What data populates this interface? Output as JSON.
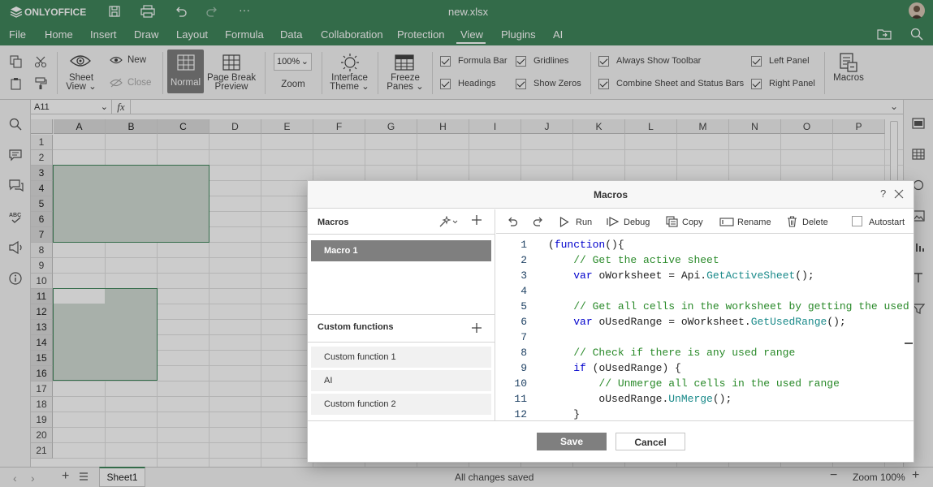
{
  "titlebar": {
    "app_name": "ONLYOFFICE",
    "file_name": "new.xlsx"
  },
  "menu": [
    "File",
    "Home",
    "Insert",
    "Draw",
    "Layout",
    "Formula",
    "Data",
    "Collaboration",
    "Protection",
    "View",
    "Plugins",
    "AI"
  ],
  "active_menu": "View",
  "ribbon": {
    "sheet_view_line1": "Sheet",
    "sheet_view_line2": "View",
    "new": "New",
    "close": "Close",
    "normal": "Normal",
    "page_break_line1": "Page Break",
    "page_break_line2": "Preview",
    "zoom_value": "100%",
    "zoom": "Zoom",
    "interface_theme_line1": "Interface",
    "interface_theme_line2": "Theme",
    "freeze_panes_line1": "Freeze",
    "freeze_panes_line2": "Panes",
    "formula_bar": "Formula Bar",
    "headings": "Headings",
    "gridlines": "Gridlines",
    "show_zeros": "Show Zeros",
    "always_show_toolbar": "Always Show Toolbar",
    "combine_bars": "Combine Sheet and Status Bars",
    "left_panel": "Left Panel",
    "right_panel": "Right Panel",
    "macros": "Macros"
  },
  "formula_bar": {
    "cell_ref": "A11",
    "fx": "fx",
    "value": ""
  },
  "columns": [
    "A",
    "B",
    "C",
    "D",
    "E",
    "F",
    "G",
    "H",
    "I",
    "J",
    "K",
    "L",
    "M",
    "N",
    "O",
    "P"
  ],
  "rows": [
    "1",
    "2",
    "3",
    "4",
    "5",
    "6",
    "7",
    "8",
    "9",
    "10",
    "11",
    "12",
    "13",
    "14",
    "15",
    "16",
    "17",
    "18",
    "19",
    "20",
    "21"
  ],
  "dialog": {
    "title": "Macros",
    "help": "?",
    "macros_header": "Macros",
    "macros": [
      "Macro 1"
    ],
    "custom_functions_header": "Custom functions",
    "custom_functions": [
      "Custom function 1",
      "AI",
      "Custom function 2"
    ],
    "toolbar": {
      "run": "Run",
      "debug": "Debug",
      "copy": "Copy",
      "rename": "Rename",
      "delete": "Delete",
      "autostart": "Autostart"
    },
    "code": [
      {
        "n": "1",
        "text": "(function(){"
      },
      {
        "n": "2",
        "text": "    // Get the active sheet"
      },
      {
        "n": "3",
        "text": "    var oWorksheet = Api.GetActiveSheet();"
      },
      {
        "n": "4",
        "text": ""
      },
      {
        "n": "5",
        "text": "    // Get all cells in the worksheet by getting the used ra"
      },
      {
        "n": "6",
        "text": "    var oUsedRange = oWorksheet.GetUsedRange();"
      },
      {
        "n": "7",
        "text": ""
      },
      {
        "n": "8",
        "text": "    // Check if there is any used range"
      },
      {
        "n": "9",
        "text": "    if (oUsedRange) {"
      },
      {
        "n": "10",
        "text": "        // Unmerge all cells in the used range"
      },
      {
        "n": "11",
        "text": "        oUsedRange.UnMerge();"
      },
      {
        "n": "12",
        "text": "    }"
      }
    ],
    "save": "Save",
    "cancel": "Cancel"
  },
  "statusbar": {
    "sheet_tab": "Sheet1",
    "status": "All changes saved",
    "zoom": "Zoom 100%"
  }
}
